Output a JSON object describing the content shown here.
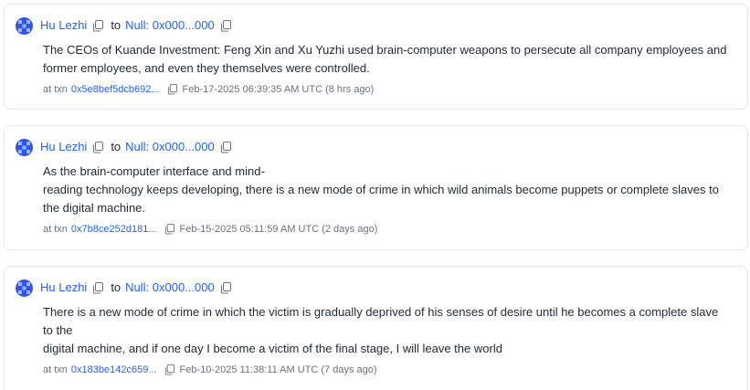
{
  "colors": {
    "link": "#2563eb",
    "text": "#1f2937",
    "muted": "#6b7280",
    "border": "#e5e7eb",
    "avatar_primary": "#2f54eb",
    "avatar_secondary": "#9db4ff"
  },
  "icons": {
    "avatar": "identicon-avatar",
    "copy": "copy-icon"
  },
  "messages": [
    {
      "sender": "Hu Lezhi",
      "to_word": "to",
      "recipient": "Null: 0x000...000",
      "lines": [
        "The CEOs of Kuande Investment: Feng Xin and Xu Yuzhi used brain-computer weapons to persecute all company employees and former employees, and even they themselves were controlled."
      ],
      "at_txn": "at txn",
      "txn_hash": "0x5e8bef5dcb692...",
      "timestamp": "Feb-17-2025 06:39:35 AM UTC (8 hrs ago)"
    },
    {
      "sender": "Hu Lezhi",
      "to_word": "to",
      "recipient": "Null: 0x000...000",
      "lines": [
        "As the brain-computer interface and mind-",
        "reading technology keeps developing, there is a new mode of crime in which wild animals become puppets or complete slaves to the digital machine."
      ],
      "at_txn": "at txn",
      "txn_hash": "0x7b8ce252d181...",
      "timestamp": "Feb-15-2025 05:11:59 AM UTC (2 days ago)"
    },
    {
      "sender": "Hu Lezhi",
      "to_word": "to",
      "recipient": "Null: 0x000...000",
      "lines": [
        "There is a new mode of crime in which the victim is gradually deprived of his senses of desire until he becomes a complete slave to the",
        "digital machine, and if one day I become a victim of the final stage, I will leave the world"
      ],
      "at_txn": "at txn",
      "txn_hash": "0x183be142c659...",
      "timestamp": "Feb-10-2025 11:38:11 AM UTC (7 days ago)"
    }
  ]
}
